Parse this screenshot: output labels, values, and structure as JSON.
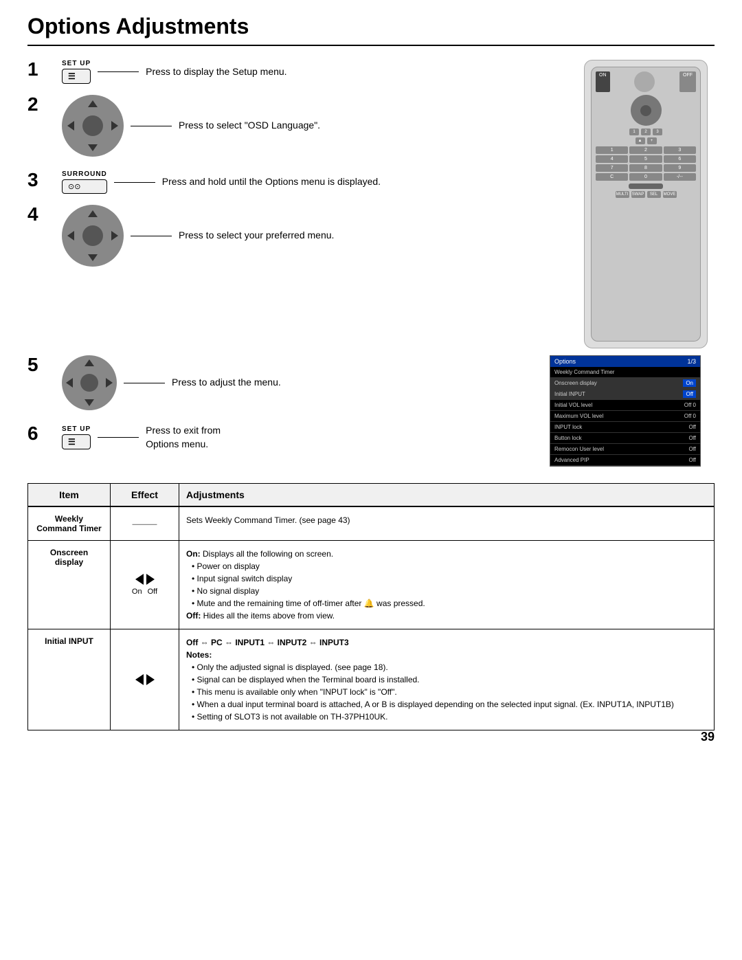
{
  "page": {
    "title": "Options Adjustments",
    "page_number": "39"
  },
  "steps": [
    {
      "number": "1",
      "label": "SET UP",
      "type": "setup_button",
      "text": "Press to display the Setup menu."
    },
    {
      "number": "2",
      "type": "dpad",
      "text": "Press to select \"OSD Language\"."
    },
    {
      "number": "3",
      "label": "SURROUND",
      "type": "surround_button",
      "text": "Press and hold until the Options menu is displayed."
    },
    {
      "number": "4",
      "type": "dpad",
      "text": "Press to select your preferred menu."
    },
    {
      "number": "5",
      "type": "dpad_small",
      "text": "Press to adjust the menu."
    },
    {
      "number": "6",
      "label": "SET UP",
      "type": "setup_button",
      "text1": "Press to exit from",
      "text2": "Options menu."
    }
  ],
  "options_menu": {
    "header_label": "Options",
    "header_page": "1/3",
    "rows": [
      {
        "label": "Weekly Command Timer",
        "value": "",
        "type": "title"
      },
      {
        "label": "Onscreen display",
        "value": "On",
        "type": "highlighted_blue"
      },
      {
        "label": "Initial INPUT",
        "value": "Off",
        "type": "highlighted_blue"
      },
      {
        "label": "Initial VOL level",
        "value": "Off  0",
        "type": "plain"
      },
      {
        "label": "Maximum VOL level",
        "value": "Off  0",
        "type": "plain"
      },
      {
        "label": "INPUT lock",
        "value": "Off",
        "type": "plain"
      },
      {
        "label": "Button lock",
        "value": "Off",
        "type": "plain"
      },
      {
        "label": "Remocon User level",
        "value": "Off",
        "type": "plain"
      },
      {
        "label": "Advanced PIP",
        "value": "Off",
        "type": "plain"
      }
    ]
  },
  "table": {
    "headers": [
      "Item",
      "Effect",
      "Adjustments"
    ],
    "rows": [
      {
        "item": "Weekly Command Timer",
        "effect_type": "dash",
        "adjustments": "Sets Weekly Command Timer. (see page 43)"
      },
      {
        "item": "Onscreen display",
        "effect_type": "arrows_on_off",
        "on_label": "On",
        "off_label": "Off",
        "adjustments_bold_on": "On:",
        "adjustments_on_text": "Displays all the following on screen.",
        "adjustments_bullets": [
          "Power on display",
          "Input signal switch display",
          "No signal display",
          "Mute and the remaining time of off-timer after  was pressed."
        ],
        "adjustments_bold_off": "Off:",
        "adjustments_off_text": "Hides all the items above from view."
      },
      {
        "item": "Initial INPUT",
        "effect_type": "arrows_only",
        "adjustments_heading": "Off ⇔ PC ⇔ INPUT1 ⇔ INPUT2 ⇔ INPUT3",
        "notes_label": "Notes:",
        "notes": [
          "Only the adjusted signal is displayed. (see page 18).",
          "Signal can be displayed when the Terminal board is installed.",
          "This menu is available only when \"INPUT lock\" is \"Off\".",
          "When a dual input terminal board is attached, A or B is displayed depending on the selected input signal. (Ex. INPUT1A, INPUT1B)",
          "Setting of SLOT3 is not available on TH-37PH10UK."
        ]
      }
    ]
  }
}
